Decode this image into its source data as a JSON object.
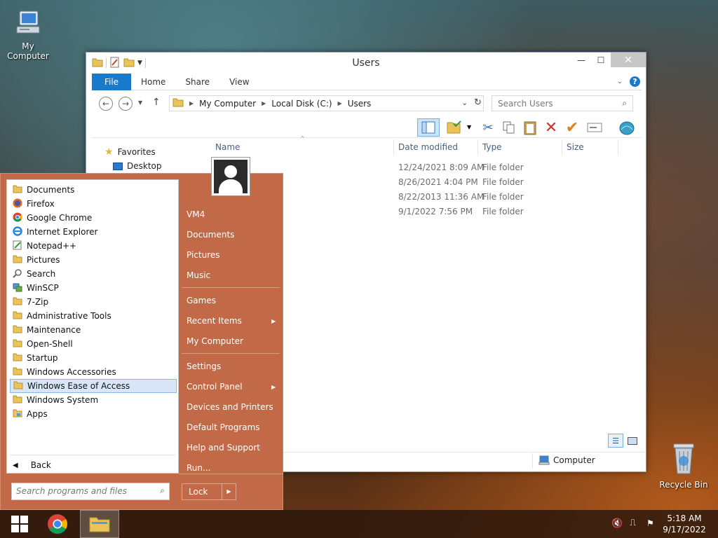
{
  "desktop": {
    "my_computer": "My Computer",
    "recycle_bin": "Recycle Bin"
  },
  "explorer": {
    "title": "Users",
    "ribbon_tabs": [
      "File",
      "Home",
      "Share",
      "View"
    ],
    "address": {
      "crumbs": [
        "My Computer",
        "Local Disk (C:)",
        "Users"
      ]
    },
    "search_placeholder": "Search Users",
    "columns": {
      "name": "Name",
      "date": "Date modified",
      "type": "Type",
      "size": "Size"
    },
    "rows": [
      {
        "date": "12/24/2021 8:09 AM",
        "type": "File folder"
      },
      {
        "date": "8/26/2021 4:04 PM",
        "type": "File folder"
      },
      {
        "date": "8/22/2013 11:36 AM",
        "type": "File folder"
      },
      {
        "date": "9/1/2022 7:56 PM",
        "type": "File folder"
      }
    ],
    "nav_pane": {
      "favorites": "Favorites",
      "desktop": "Desktop"
    },
    "status_location": "Computer"
  },
  "start_menu": {
    "programs": [
      "Documents",
      "Firefox",
      "Google Chrome",
      "Internet Explorer",
      "Notepad++",
      "Pictures",
      "Search",
      "WinSCP",
      "7-Zip",
      "Administrative Tools",
      "Maintenance",
      "Open-Shell",
      "Startup",
      "Windows Accessories",
      "Windows Ease of Access",
      "Windows System",
      "Apps"
    ],
    "selected_index": 14,
    "back": "Back",
    "search_placeholder": "Search programs and files",
    "right_items": {
      "user": "VM4",
      "documents": "Documents",
      "pictures": "Pictures",
      "music": "Music",
      "games": "Games",
      "recent": "Recent Items",
      "computer": "My Computer",
      "settings": "Settings",
      "control_panel": "Control Panel",
      "devices": "Devices and Printers",
      "default_programs": "Default Programs",
      "help": "Help and Support",
      "run": "Run..."
    },
    "lock": "Lock"
  },
  "taskbar": {
    "time": "5:18 AM",
    "date": "9/17/2022"
  },
  "colors": {
    "accent": "#1979ca",
    "start_menu_bg": "#c26a48",
    "selected_bg": "#d8e6f7"
  }
}
